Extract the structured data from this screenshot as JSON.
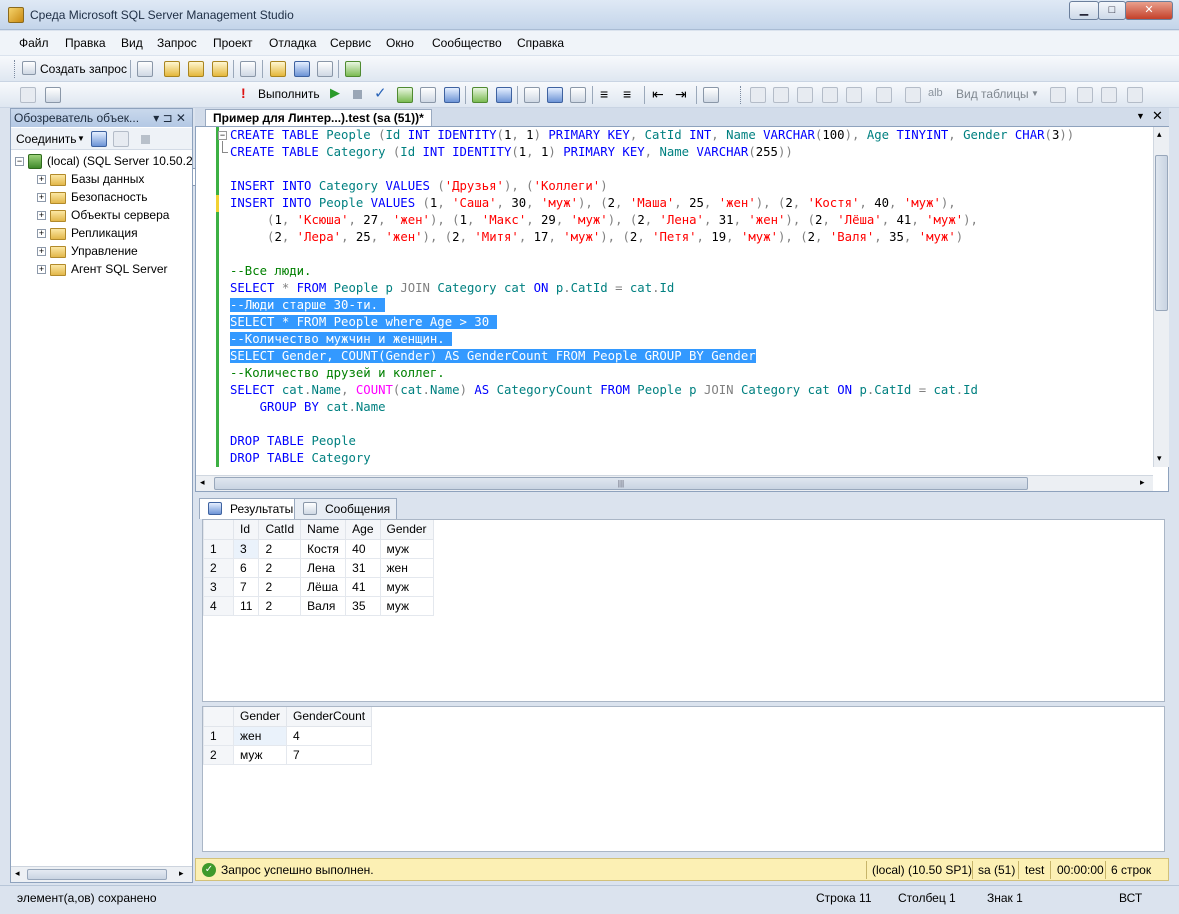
{
  "window": {
    "title": "Среда Microsoft SQL Server Management Studio",
    "min": "▁",
    "max": "□",
    "close": "✕"
  },
  "menu": [
    "Файл",
    "Правка",
    "Вид",
    "Запрос",
    "Проект",
    "Отладка",
    "Сервис",
    "Окно",
    "Сообщество",
    "Справка"
  ],
  "toolbar": {
    "new_query": "Создать запрос",
    "database": "test",
    "execute": "Выполнить",
    "table_view": "Вид таблицы"
  },
  "explorer": {
    "title": "Обозреватель объек...",
    "pin": "▾ ⊐ ✕",
    "connect": "Соединить",
    "server": "(local) (SQL Server 10.50.2",
    "nodes": [
      "Базы данных",
      "Безопасность",
      "Объекты сервера",
      "Репликация",
      "Управление",
      "Агент SQL Server"
    ]
  },
  "editor": {
    "tab": "Пример для Линтер...).test (sa (51))*"
  },
  "results": {
    "tabs": [
      "Результаты",
      "Сообщения"
    ],
    "grid1": {
      "columns": [
        "",
        "Id",
        "CatId",
        "Name",
        "Age",
        "Gender"
      ],
      "rows": [
        [
          "1",
          "3",
          "2",
          "Костя",
          "40",
          "муж"
        ],
        [
          "2",
          "6",
          "2",
          "Лена",
          "31",
          "жен"
        ],
        [
          "3",
          "7",
          "2",
          "Лёша",
          "41",
          "муж"
        ],
        [
          "4",
          "11",
          "2",
          "Валя",
          "35",
          "муж"
        ]
      ]
    },
    "grid2": {
      "columns": [
        "",
        "Gender",
        "GenderCount"
      ],
      "rows": [
        [
          "1",
          "жен",
          "4"
        ],
        [
          "2",
          "муж",
          "7"
        ]
      ]
    }
  },
  "query_status": {
    "message": "Запрос успешно выполнен.",
    "server": "(local) (10.50 SP1)",
    "user": "sa (51)",
    "db": "test",
    "time": "00:00:00",
    "rows": "6 строк"
  },
  "status": {
    "left": "элемент(а,ов) сохранено",
    "line": "Строка 11",
    "col": "Столбец 1",
    "ch": "Знак 1",
    "ins": "ВСТ"
  }
}
